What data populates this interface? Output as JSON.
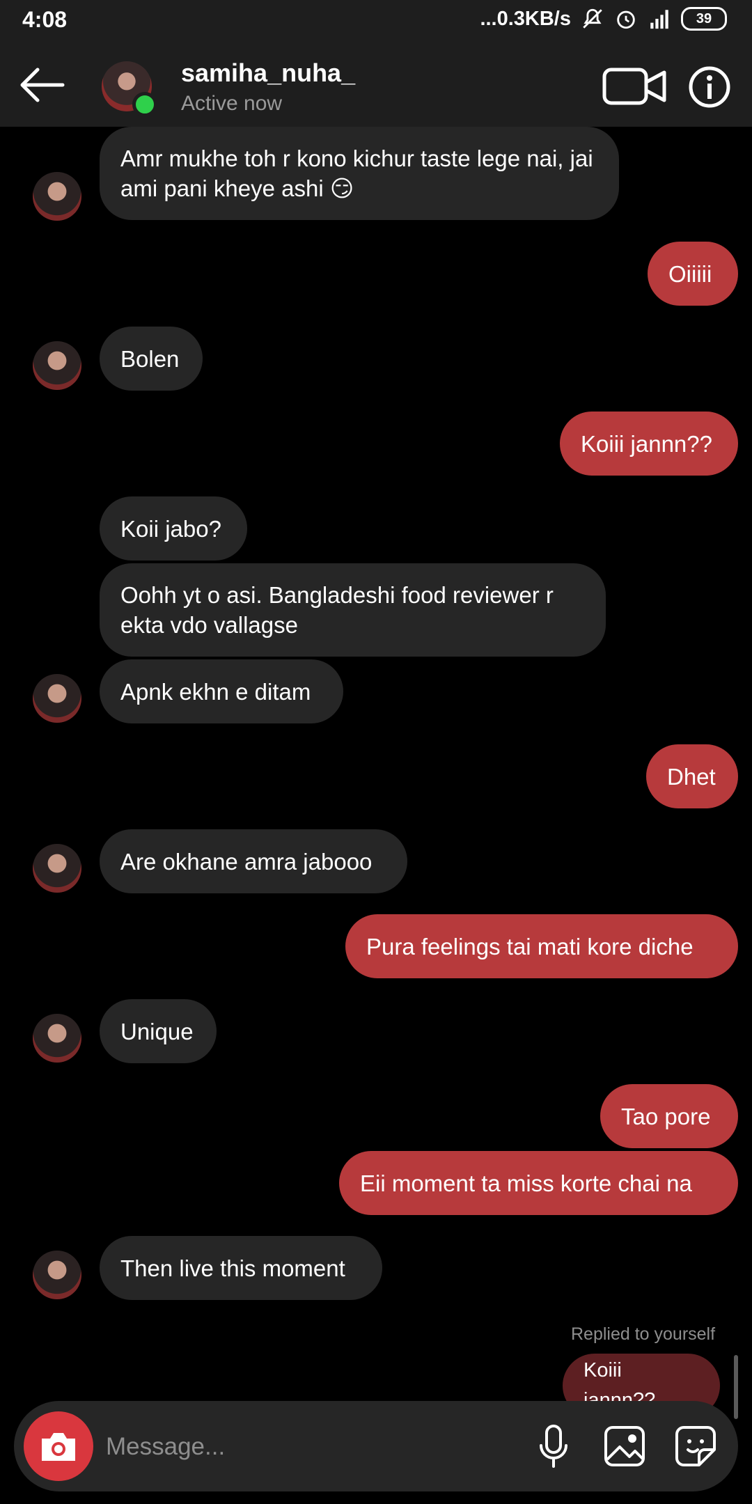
{
  "status_bar": {
    "time": "4:08",
    "network_speed": "...0.3KB/s",
    "battery": "39"
  },
  "header": {
    "username": "samiha_nuha_",
    "status": "Active now"
  },
  "messages": [
    {
      "from": "them",
      "text": "Amr mukhe toh r kono kichur taste lege nai, jai ami pani kheye ashi 😏"
    },
    {
      "from": "me",
      "text": "Oiiiii"
    },
    {
      "from": "them",
      "text": "Bolen"
    },
    {
      "from": "me",
      "text": "Koiii jannn??"
    },
    {
      "from": "them",
      "text": "Koii jabo?"
    },
    {
      "from": "them",
      "text": "Oohh yt o asi. Bangladeshi food reviewer r ekta vdo vallagse"
    },
    {
      "from": "them",
      "text": "Apnk ekhn e ditam"
    },
    {
      "from": "me",
      "text": "Dhet"
    },
    {
      "from": "them",
      "text": "Are okhane amra jabooo"
    },
    {
      "from": "me",
      "text": "Pura feelings tai mati kore diche"
    },
    {
      "from": "them",
      "text": "Unique"
    },
    {
      "from": "me",
      "text": "Tao pore"
    },
    {
      "from": "me",
      "text": "Eii moment ta miss korte chai na"
    },
    {
      "from": "them",
      "text": "Then live this moment"
    },
    {
      "from": "me",
      "text": "Koiii jannn??"
    }
  ],
  "reply_note": "Replied to yourself",
  "composer": {
    "placeholder": "Message..."
  },
  "colors": {
    "outgoing_bubble": "#b73a3c",
    "incoming_bubble": "#262626",
    "online_dot": "#2fd04b",
    "camera_button": "#d9373e"
  }
}
